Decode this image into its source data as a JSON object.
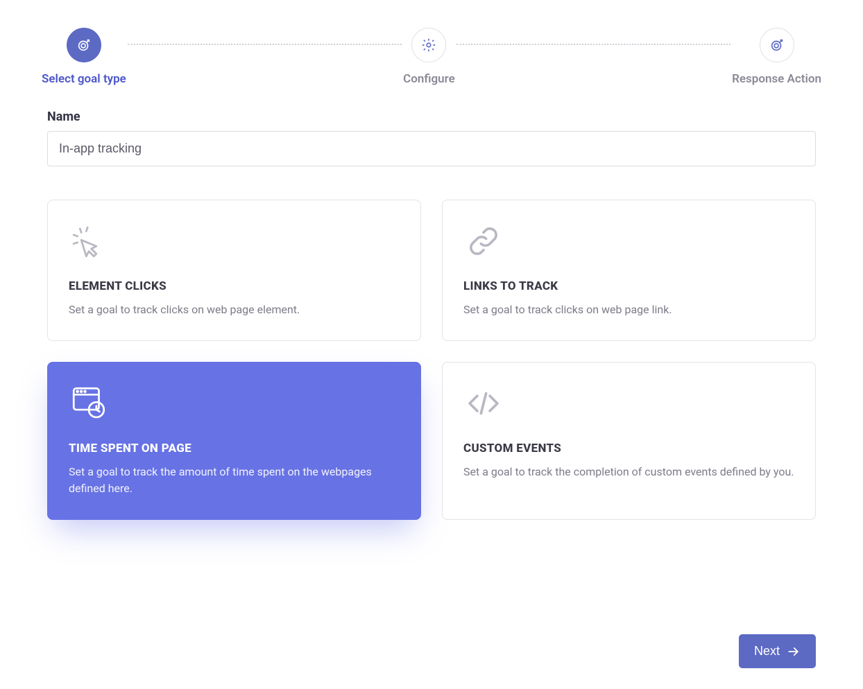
{
  "stepper": {
    "steps": [
      {
        "label": "Select goal type",
        "active": true
      },
      {
        "label": "Configure",
        "active": false
      },
      {
        "label": "Response Action",
        "active": false
      }
    ]
  },
  "form": {
    "name_label": "Name",
    "name_value": "In-app tracking"
  },
  "cards": [
    {
      "title": "ELEMENT CLICKS",
      "desc": "Set a goal to track clicks on web page element.",
      "selected": false,
      "icon": "click-icon"
    },
    {
      "title": "LINKS TO TRACK",
      "desc": "Set a goal to track clicks on web page link.",
      "selected": false,
      "icon": "link-icon"
    },
    {
      "title": "TIME SPENT ON PAGE",
      "desc": "Set a goal to track the amount of time spent on the webpages defined here.",
      "selected": true,
      "icon": "time-page-icon"
    },
    {
      "title": "CUSTOM EVENTS",
      "desc": "Set a goal to track the completion of custom events defined by you.",
      "selected": false,
      "icon": "code-icon"
    }
  ],
  "footer": {
    "next_label": "Next"
  }
}
